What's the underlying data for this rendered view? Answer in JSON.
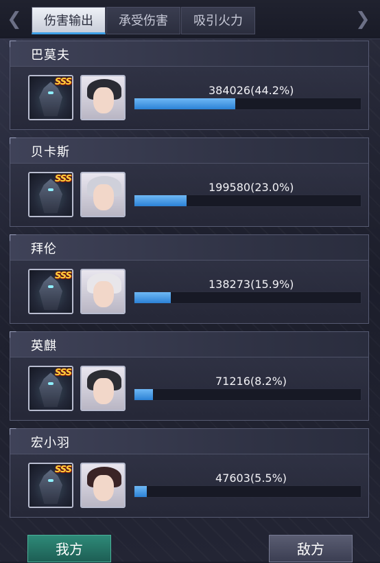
{
  "tabs": [
    {
      "label": "伤害输出",
      "active": true
    },
    {
      "label": "承受伤害",
      "active": false
    },
    {
      "label": "吸引火力",
      "active": false
    }
  ],
  "nav": {
    "prev_icon": "chevron-left-icon",
    "next_icon": "chevron-right-icon"
  },
  "players": [
    {
      "name": "巴莫夫",
      "value": "384026(44.2%)",
      "fraction": 0.442,
      "rank_badge": "SSS",
      "hair": "#2a2b33"
    },
    {
      "name": "贝卡斯",
      "value": "199580(23.0%)",
      "fraction": 0.23,
      "rank_badge": "SSS",
      "hair": "#cfd0da"
    },
    {
      "name": "拜伦",
      "value": "138273(15.9%)",
      "fraction": 0.159,
      "rank_badge": "SSS",
      "hair": "#e8e6ea"
    },
    {
      "name": "英麒",
      "value": "71216(8.2%)",
      "fraction": 0.082,
      "rank_badge": "SSS",
      "hair": "#2c2d33"
    },
    {
      "name": "宏小羽",
      "value": "47603(5.5%)",
      "fraction": 0.055,
      "rank_badge": "SSS",
      "hair": "#3a2426"
    }
  ],
  "buttons": {
    "mine": "我方",
    "enemy": "敌方"
  },
  "colors": {
    "bar": "#3a8fe0",
    "tab_active_underline": "#3ea0e8",
    "mine_button": "#2e8a78"
  }
}
